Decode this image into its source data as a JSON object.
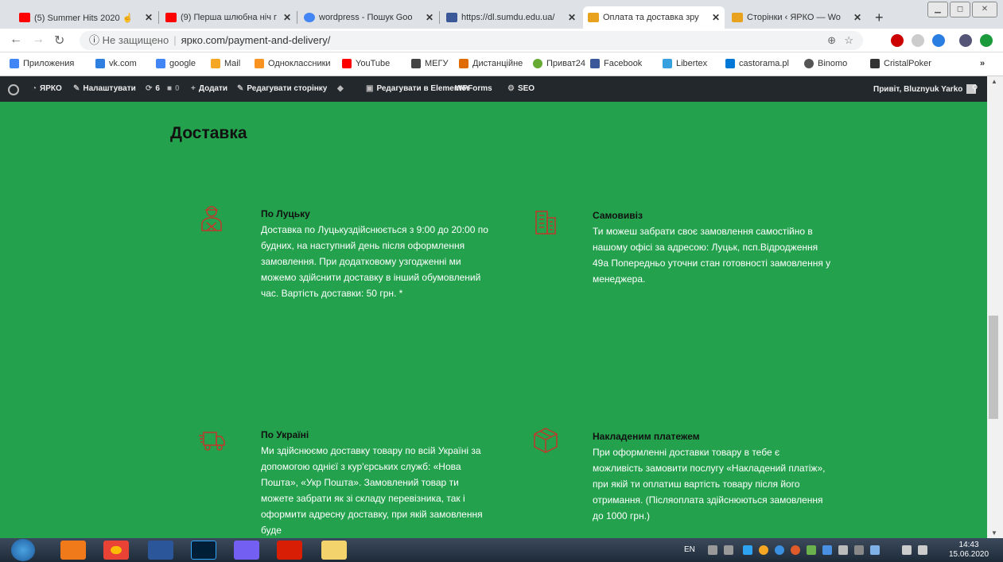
{
  "browser": {
    "tabs": [
      {
        "title": "(5) Summer Hits 2020 ☝",
        "icon_color": "#ff0000"
      },
      {
        "title": "(9) Перша шлюбна ніч г",
        "icon_color": "#ff0000"
      },
      {
        "title": "wordpress - Пошук Goo",
        "icon_color": "#4285f4"
      },
      {
        "title": "https://dl.sumdu.edu.ua/",
        "icon_color": "#3b5998"
      },
      {
        "title": "Оплата та доставка зру",
        "icon_color": "#e8a21e",
        "active": true
      },
      {
        "title": "Сторінки ‹ ЯРКО — Wo",
        "icon_color": "#e8a21e"
      }
    ],
    "new_tab": "+",
    "insecure_label": "Не защищено",
    "url": "ярко.com/payment-and-delivery/",
    "bookmarks": [
      {
        "label": "Приложения",
        "color": "#4285f4"
      },
      {
        "label": "vk.com",
        "color": "#2f7fe0"
      },
      {
        "label": "google",
        "color": "#4285f4"
      },
      {
        "label": "Mail",
        "color": "#f5a623"
      },
      {
        "label": "Одноклассники",
        "color": "#f7931e"
      },
      {
        "label": "YouTube",
        "color": "#ff0000"
      },
      {
        "label": "МЕГУ",
        "color": "#444"
      },
      {
        "label": "Дистанційне",
        "color": "#e06b00"
      },
      {
        "label": "Приват24",
        "color": "#66aa33"
      },
      {
        "label": "Facebook",
        "color": "#3b5998"
      },
      {
        "label": "Libertex",
        "color": "#39a0e0"
      },
      {
        "label": "castorama.pl",
        "color": "#0078d7"
      },
      {
        "label": "Binomo",
        "color": "#555"
      },
      {
        "label": "CristalPoker",
        "color": "#333"
      }
    ],
    "bookmarks_more": "»"
  },
  "wp_admin": {
    "site": "ЯРКО",
    "customize": "Налаштувати",
    "updates": "6",
    "comments": "0",
    "add": "Додати",
    "edit_page": "Редагувати сторінку",
    "elementor": "Редагувати в Elementor",
    "wpforms": "WPForms",
    "seo": "SEO",
    "greeting": "Привіт, Bluznyuk Yarko"
  },
  "page": {
    "heading": "Доставка",
    "blocks": [
      {
        "title": "По Луцьку",
        "icon": "courier-icon",
        "text": "Доставка по Луцькуздійснюється з 9:00 до 20:00 по будних, на наступний день після оформлення замовлення. При додатковому узгодженні ми можемо здійснити доставку в інший обумовлений час. Вартість доставки: 50 грн. *"
      },
      {
        "title": "Самовивіз",
        "icon": "building-icon",
        "text": "Ти можеш забрати своє замовлення самостійно в нашому офісі за адресою: Луцьк, псп.Відродження 49а Попередньо уточни стан готовності замовлення у менеджера."
      },
      {
        "title": "По Україні",
        "icon": "truck-icon",
        "text": "Ми здійснюємо доставку товару по всій Україні за допомогою однієї з кур'єрських служб: «Нова Пошта», «Укр Пошта». Замовлений товар ти можете забрати як зі складу перевізника, так і оформити адресну доставку, при якій замовлення буде"
      },
      {
        "title": "Накладеним платежем",
        "icon": "box-icon",
        "text": "При оформленні доставки товару в тебе є можливість замовити послугу «Накладений платіж», при якій ти оплатиш вартість товару після його отримання. (Післяоплата здійснюються замовлення до 1000 грн.)"
      }
    ],
    "accent_color": "#23a14d"
  },
  "taskbar": {
    "lang": "EN",
    "time": "14:43",
    "date": "15.06.2020"
  }
}
